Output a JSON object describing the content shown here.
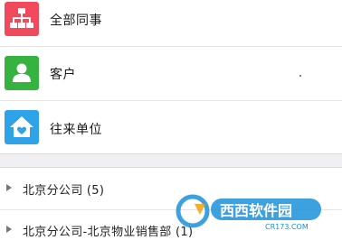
{
  "contacts": {
    "items": [
      {
        "label": "全部同事",
        "icon": "org-chart-icon",
        "color": "#f04a5c"
      },
      {
        "label": "客户",
        "icon": "person-icon",
        "color": "#35b240"
      },
      {
        "label": "往来单位",
        "icon": "home-heart-icon",
        "color": "#2ea3e8"
      }
    ]
  },
  "groups": {
    "items": [
      {
        "label": "北京分公司 (5)",
        "icon": "expand-arrow-icon"
      },
      {
        "label": "北京分公司-北京物业销售部 (1)",
        "icon": "expand-arrow-icon"
      }
    ]
  },
  "watermark": {
    "brand_text": "西西软件园",
    "url_text": "CR173.COM"
  }
}
